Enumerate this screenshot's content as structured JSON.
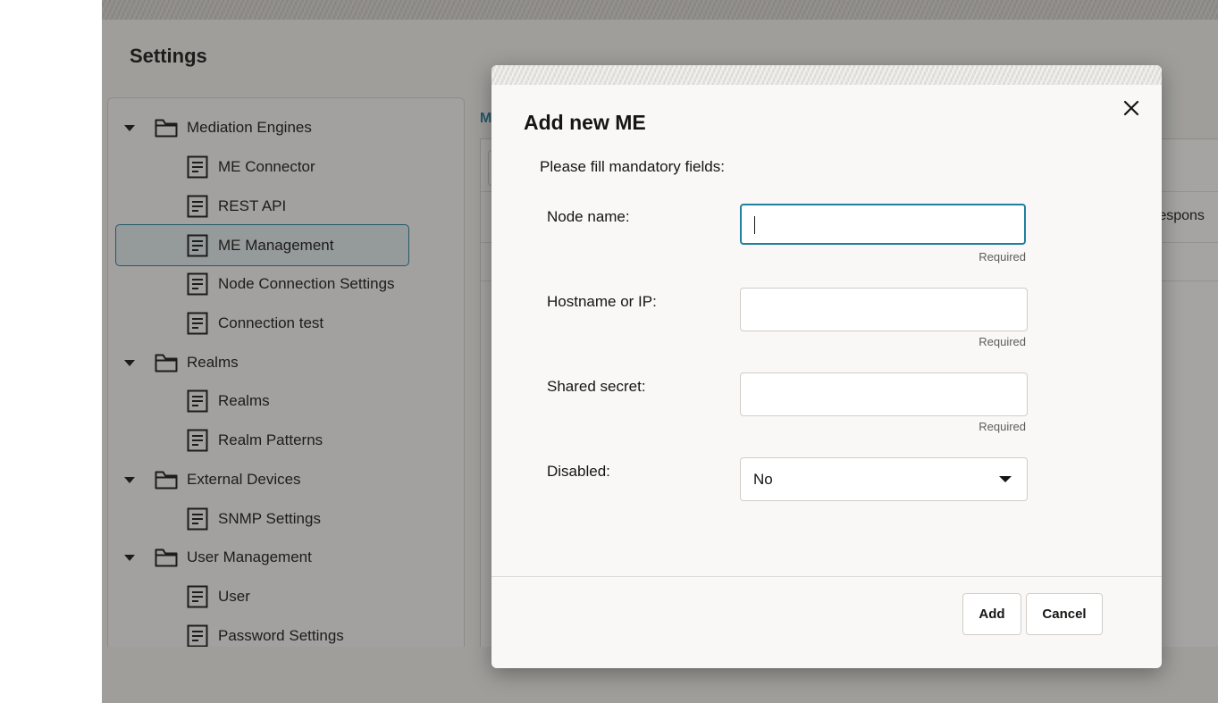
{
  "page": {
    "title": "Settings",
    "link_fragment": "M",
    "background_column_fragment": "respons"
  },
  "tree": {
    "items": [
      {
        "type": "group",
        "label": "Mediation Engines",
        "icon": "folder-icon",
        "expanded": true
      },
      {
        "type": "item",
        "label": "ME Connector",
        "icon": "document-icon"
      },
      {
        "type": "item",
        "label": "REST API",
        "icon": "document-icon"
      },
      {
        "type": "item",
        "label": "ME Management",
        "icon": "document-icon",
        "selected": true
      },
      {
        "type": "item",
        "label": "Node Connection Settings",
        "icon": "document-icon"
      },
      {
        "type": "item",
        "label": "Connection test",
        "icon": "document-icon"
      },
      {
        "type": "group",
        "label": "Realms",
        "icon": "folder-icon",
        "expanded": true
      },
      {
        "type": "item",
        "label": "Realms",
        "icon": "document-icon"
      },
      {
        "type": "item",
        "label": "Realm Patterns",
        "icon": "document-icon"
      },
      {
        "type": "group",
        "label": "External Devices",
        "icon": "folder-icon",
        "expanded": true
      },
      {
        "type": "item",
        "label": "SNMP Settings",
        "icon": "document-icon"
      },
      {
        "type": "group",
        "label": "User Management",
        "icon": "folder-icon",
        "expanded": true
      },
      {
        "type": "item",
        "label": "User",
        "icon": "document-icon"
      },
      {
        "type": "item",
        "label": "Password Settings",
        "icon": "document-icon"
      }
    ]
  },
  "dialog": {
    "title": "Add new ME",
    "intro": "Please fill mandatory fields:",
    "fields": {
      "node_name": {
        "label": "Node name:",
        "value": "",
        "hint": "Required"
      },
      "hostname": {
        "label": "Hostname or IP:",
        "value": "",
        "hint": "Required"
      },
      "shared_secret": {
        "label": "Shared secret:",
        "value": "",
        "hint": "Required"
      },
      "disabled": {
        "label": "Disabled:",
        "selected": "No"
      }
    },
    "buttons": {
      "add": "Add",
      "cancel": "Cancel"
    },
    "close_icon": "close-icon"
  },
  "colors": {
    "accent": "#227e9e",
    "text": "#161513",
    "dialog_bg": "#f9f8f6"
  }
}
